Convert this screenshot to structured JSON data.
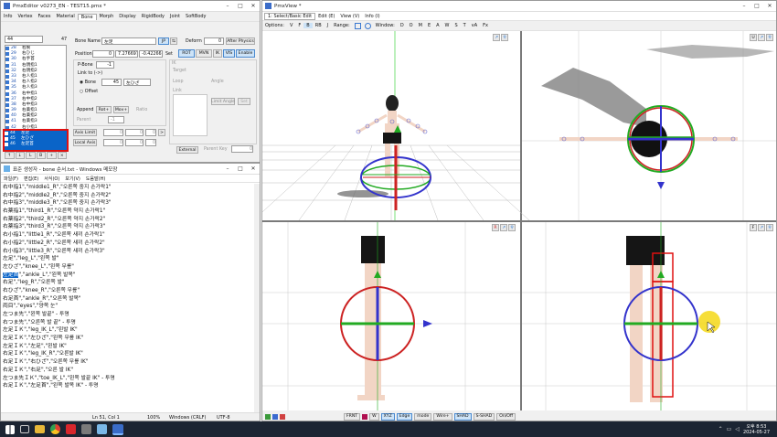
{
  "pmx_editor": {
    "title": "PmxEditor v0273_EN - TEST15.pmx *",
    "menu": [
      "Info",
      "Vertex",
      "Faces",
      "Material",
      "Bone",
      "Morph",
      "Display",
      "RigidBody",
      "Joint",
      "SoftBody"
    ],
    "active_tab": "Bone",
    "count_value": "44",
    "count_total": "47",
    "bone_list": [
      {
        "n": "28",
        "name": "右腕"
      },
      {
        "n": "29",
        "name": "右ひじ"
      },
      {
        "n": "30",
        "name": "右手首"
      },
      {
        "n": "31",
        "name": "右親指1"
      },
      {
        "n": "32",
        "name": "右親指2"
      },
      {
        "n": "33",
        "name": "右人指1"
      },
      {
        "n": "34",
        "name": "右人指2"
      },
      {
        "n": "35",
        "name": "右人指3"
      },
      {
        "n": "36",
        "name": "右中指1"
      },
      {
        "n": "37",
        "name": "右中指2"
      },
      {
        "n": "38",
        "name": "右中指3"
      },
      {
        "n": "39",
        "name": "右薬指1"
      },
      {
        "n": "40",
        "name": "右薬指2"
      },
      {
        "n": "41",
        "name": "右薬指3"
      },
      {
        "n": "42",
        "name": "右小指1"
      },
      {
        "n": "43",
        "name": "右小指2"
      }
    ],
    "selected_items": [
      {
        "n": "44",
        "name": "左足"
      },
      {
        "n": "45",
        "name": "左ひざ"
      },
      {
        "n": "46",
        "name": "左足首"
      }
    ],
    "list_buttons": [
      "↑",
      "↓",
      "L",
      "B",
      "+",
      "×"
    ],
    "bone_name_label": "Bone Name",
    "bone_name_value": "左足",
    "bone_name_lang": "JP",
    "deform_label": "Deform",
    "deform_value": "0",
    "after_physics": "After Physics",
    "position_label": "Position",
    "pos_x": "0",
    "pos_y": "7.276697",
    "pos_z": "-0.422660",
    "set_label": "Set",
    "mode_buttons": [
      "ROT",
      "MVN",
      "IK",
      "VIS",
      "Enable"
    ],
    "pbone_label": "P-Bone",
    "pbone_value": "-1",
    "link_to": "Link to (->)",
    "bone_radio": "Bone",
    "bone_radio_value": "45",
    "bone_radio_name": "左ひざ",
    "offset_radio": "Offset",
    "append_label": "Append",
    "append_rot": "Rot+",
    "append_mov": "Mov+",
    "append_ratio": "Ratio",
    "parent_label": "Parent",
    "parent_value": "-1",
    "axis_limit": "Axis Limit",
    "local_axis": "Local Axis",
    "zero": "0",
    "ik_label": "IK",
    "target_label": "Target",
    "loop_label": "Loop",
    "angle_label": "Angle",
    "link_label": "Link",
    "limit_angle": "Limit Angle",
    "external": "External",
    "parent_key": "Parent Key",
    "value_zero": "0"
  },
  "notepad": {
    "title": "표준 생성자 - bone 순서.txt - Windows 메모장",
    "menu": [
      "파일(F)",
      "편집(E)",
      "서식(O)",
      "보기(V)",
      "도움말(H)"
    ],
    "lines": [
      "右中指1\",\"middle1_R\",\"오른쪽 중지 손가락1\"",
      "右中指2\",\"middle2_R\",\"오른쪽 중지 손가락2\"",
      "右中指3\",\"middle3_R\",\"오른쪽 중지 손가락3\"",
      "右薬指1\",\"third1_R\",\"오른쪽 약지 손가락1\"",
      "右薬指2\",\"third2_R\",\"오른쪽 약지 손가락2\"",
      "右薬指3\",\"third3_R\",\"오른쪽 약지 손가락3\"",
      "右小指1\",\"little1_R\",\"오른쪽 새끼 손가락1\"",
      "右小指2\",\"little2_R\",\"오른쪽 새끼 손가락2\"",
      "右小指3\",\"little3_R\",\"오른쪽 새끼 손가락3\"",
      "左足\",\"leg_L\",\"왼쪽 발\"",
      "左ひざ\",\"knee_L\",\"왼쪽 무릎\"",
      "左足首\",\"ankle_L\",\"왼쪽 발목\"",
      "右足\",\"leg_R\",\"오른쪽 발\"",
      "右ひざ\",\"knee_R\",\"오른쪽 무릎\"",
      "右足首\",\"ankle_R\",\"오른쪽 발목\"",
      "両目\",\"eyes\",\"양쪽 눈\"",
      "左つま先\",\"왼쪽 발끝\" - 투명",
      "右つま先\",\"오른쪽 발 끝\" - 투명",
      "左足ＩＫ\",\"leg_IK_L\",\"왼발 IK\"",
      "左足ＩＫ\",\"左ひざ\",\"왼쪽 무릎 IK\"",
      "左足ＩＫ\",\"左足\",\"왼발 IK\"",
      "右足ＩＫ\",\"leg_IK_R\",\"오른발 IK\"",
      "右足ＩＫ\",\"右ひざ\",\"오른쪽 무릎 IK\"",
      "右足ＩＫ\",\"右足\",\"오른 발 IK\"",
      "左つま先ＩＫ\",\"toe_IK_L\",\"왼쪽 발끝 IK\" - 투명",
      "右足ＩＫ\",\"左足首\",\"왼쪽 발목 IK\" - 투명"
    ],
    "highlight_line_index": 11,
    "highlight_text": "左足首",
    "status": [
      "Ln 51, Col 1",
      "100%",
      "Windows (CRLF)",
      "UTF-8"
    ]
  },
  "pmx_view": {
    "title": "PmxView *",
    "menu_select": "1: Select/Basic Edit",
    "menu": [
      "Edit (E)",
      "View (V)",
      "Info (I)"
    ],
    "options_label": "Options:",
    "option_letters": [
      "V",
      "F",
      "B",
      "RB",
      "J"
    ],
    "range_label": "Range:",
    "window_label": "Window:",
    "window_letters": [
      "D",
      "O",
      "M",
      "E",
      "A",
      "W",
      "S",
      "T"
    ],
    "va_label": "vA",
    "fx_label": "Fx",
    "panel_tags": [
      "U",
      "R",
      "F"
    ],
    "bottom_bar": [
      "FRNT",
      "W",
      "XYZ",
      "Edge",
      "mode",
      "Wire+",
      "SHAD",
      "S-SHAD",
      "On/Off"
    ]
  },
  "taskbar": {
    "time": "오후 8:53",
    "date": "2024-05-27"
  },
  "colors": {
    "accent": "#0a64c8",
    "rot_red": "#cc2222",
    "rot_green": "#22aa22",
    "rot_blue": "#3333cc",
    "select_red": "#e01010",
    "cursor_yellow": "#f5d816"
  }
}
